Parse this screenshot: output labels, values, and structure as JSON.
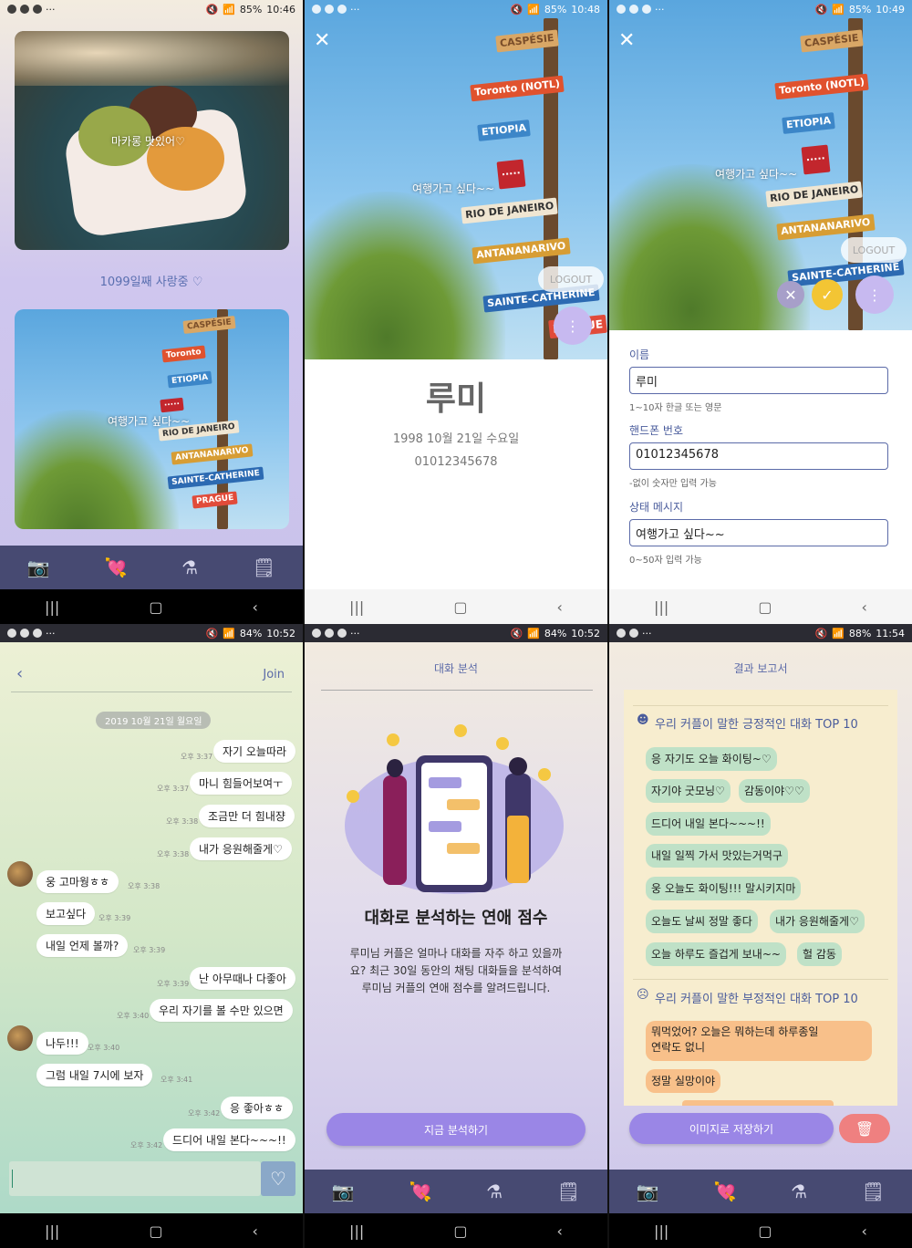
{
  "status_bars": [
    {
      "battery": "85%",
      "time": "10:46"
    },
    {
      "battery": "85%",
      "time": "10:48"
    },
    {
      "battery": "85%",
      "time": "10:49"
    },
    {
      "battery": "84%",
      "time": "10:52"
    },
    {
      "battery": "84%",
      "time": "10:52"
    },
    {
      "battery": "88%",
      "time": "11:54"
    }
  ],
  "home": {
    "photo1_caption": "마카롱 맛있어♡",
    "days_counter": "1099일째 사랑중 ♡",
    "photo2_caption": "여행가고 싶다~~"
  },
  "profile": {
    "status_caption": "여행가고 싶다~~",
    "logout": "LOGOUT",
    "name": "루미",
    "birthday": "1998 10월 21일 수요일",
    "phone": "01012345678"
  },
  "edit": {
    "status_caption": "여행가고 싶다~~",
    "logout": "LOGOUT",
    "name_label": "이름",
    "name_value": "루미",
    "name_hint": "1~10자 한글 또는 영문",
    "phone_label": "핸드폰 번호",
    "phone_value": "01012345678",
    "phone_hint": "-없이 숫자만 입력 가능",
    "status_label": "상태 메시지",
    "status_value": "여행가고 싶다~~",
    "status_hint": "0~50자 입력 가능"
  },
  "chat": {
    "join": "Join",
    "date": "2019 10월 21일 월요일",
    "messages": [
      {
        "text": "자기 오늘따라",
        "time": "오후 3:37"
      },
      {
        "text": "마니 힘들어보여ㅜ",
        "time": "오후 3:37"
      },
      {
        "text": "조금만 더 힘내쟝",
        "time": "오후 3:38"
      },
      {
        "text": "내가 응원해줄게♡",
        "time": "오후 3:38"
      },
      {
        "text": "웅 고마웡ㅎㅎ",
        "time": "오후 3:38"
      },
      {
        "text": "보고싶다",
        "time": "오후 3:39"
      },
      {
        "text": "내일 언제 볼까?",
        "time": "오후 3:39"
      },
      {
        "text": "난 아무때나 다좋아",
        "time": "오후 3:39"
      },
      {
        "text": "우리 자기를 볼 수만 있으면",
        "time": "오후 3:40"
      },
      {
        "text": "나두!!!",
        "time": "오후 3:40"
      },
      {
        "text": "그럼 내일 7시에 보자",
        "time": "오후 3:41"
      },
      {
        "text": "응 좋아ㅎㅎ",
        "time": "오후 3:42"
      },
      {
        "text": "드디어 내일 본다~~~!!",
        "time": "오후 3:42"
      }
    ]
  },
  "analysis": {
    "title": "대화 분석",
    "heading": "대화로 분석하는 연애 점수",
    "description": "루미님 커플은 얼마나 대화를 자주 하고 있을까요? 최근 30일 동안의 채팅 대화들을 분석하여 루미님 커플의 연애 점수를 알려드립니다.",
    "button": "지금 분석하기"
  },
  "report": {
    "title": "결과 보고서",
    "positive_title": "우리 커플이 말한 긍정적인 대화 TOP 10",
    "positive": [
      "응 자기도 오늘 화이팅~♡",
      "자기야 굿모닝♡",
      "감동이야♡♡",
      "드디어 내일 본다~~~!!",
      "내일 일찍 가서 맛있는거먹구",
      "웅 오늘도 화이팅!!! 말시키지마",
      "오늘도 날씨 정말 좋다",
      "내가 응원해줄게♡",
      "오늘 하루도 즐겁게 보내~~",
      "헐 감동"
    ],
    "negative_title": "우리 커플이 말한 부정적인 대화 TOP 10",
    "negative": [
      "뭐먹었어? 오늘은 뭐하는데 하루종일",
      "연락도 없니",
      "정말 실망이야"
    ],
    "save_button": "이미지로 저장하기"
  }
}
